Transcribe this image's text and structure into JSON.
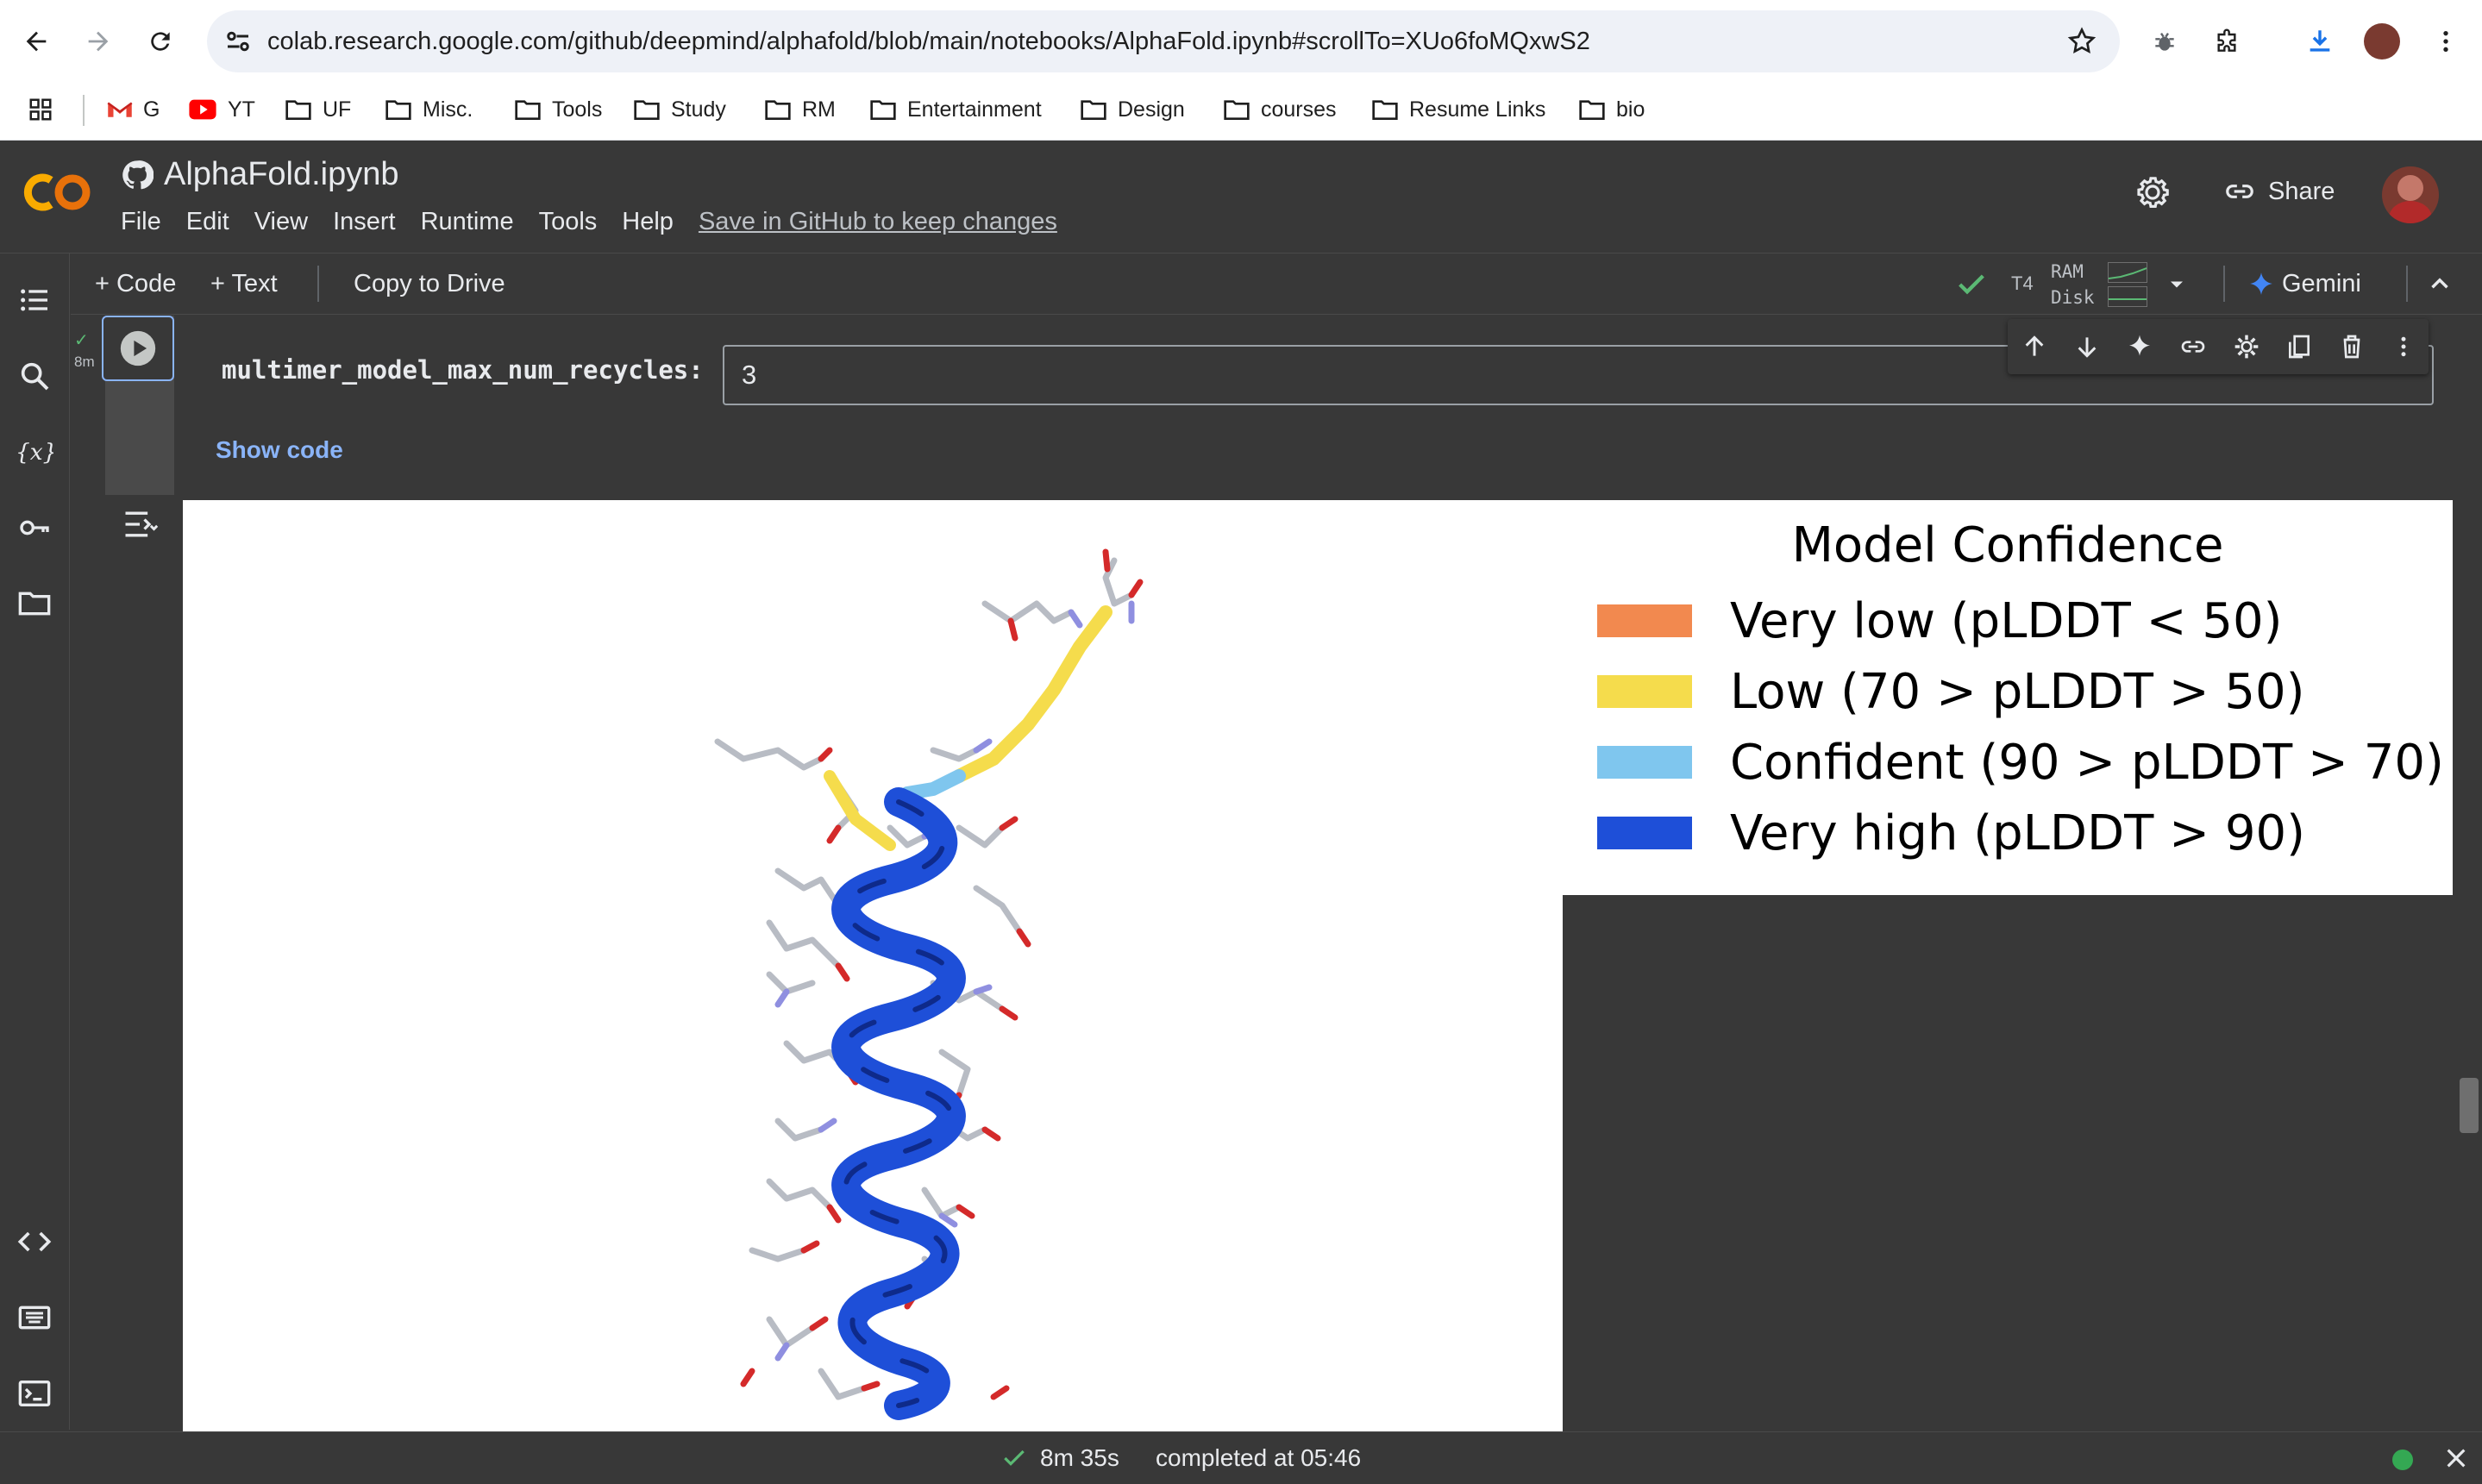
{
  "browser": {
    "url": "colab.research.google.com/github/deepmind/alphafold/blob/main/notebooks/AlphaFold.ipynb#scrollTo=XUo6foMQxwS2",
    "bookmarks": [
      "G",
      "YT",
      "UF",
      "Misc.",
      "Tools",
      "Study",
      "RM",
      "Entertainment",
      "Design",
      "courses",
      "Resume Links",
      "bio"
    ]
  },
  "header": {
    "notebook_title": "AlphaFold.ipynb",
    "menu": [
      "File",
      "Edit",
      "View",
      "Insert",
      "Runtime",
      "Tools",
      "Help"
    ],
    "save_link": "Save in GitHub to keep changes",
    "share_label": "Share"
  },
  "toolbar": {
    "add_code": "+ Code",
    "add_text": "+ Text",
    "copy_to_drive": "Copy to Drive",
    "runtime_type": "T4",
    "ram_label": "RAM",
    "disk_label": "Disk",
    "gemini_label": "Gemini"
  },
  "cell": {
    "exec_time": "8m",
    "param_label": "multimer_model_max_num_recycles:",
    "param_value": "3",
    "show_code": "Show code"
  },
  "legend": {
    "title": "Model Confidence",
    "items": [
      {
        "label": "Very low (pLDDT < 50)",
        "color": "#f2894f"
      },
      {
        "label": "Low (70 > pLDDT > 50)",
        "color": "#f5dc4c"
      },
      {
        "label": "Confident (90 > pLDDT > 70)",
        "color": "#7fc6ee"
      },
      {
        "label": "Very high (pLDDT > 90)",
        "color": "#1e4fd8"
      }
    ]
  },
  "status": {
    "elapsed": "8m 35s",
    "completed": "completed at 05:46"
  },
  "colors": {
    "accent": "#8ab4f8",
    "background": "#383838",
    "success": "#5bb974"
  }
}
